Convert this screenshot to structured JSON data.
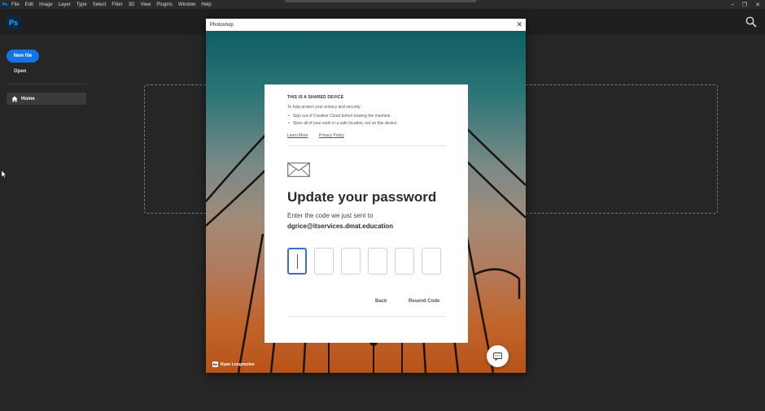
{
  "menubar": {
    "app_badge": "Ps",
    "items": [
      "File",
      "Edit",
      "Image",
      "Layer",
      "Type",
      "Select",
      "Filter",
      "3D",
      "View",
      "Plugins",
      "Window",
      "Help"
    ]
  },
  "appbar": {
    "logo": "Ps",
    "search_icon": "search-icon"
  },
  "sidebar": {
    "new_file": "New file",
    "open": "Open",
    "home": "Home"
  },
  "dialog": {
    "title": "Photoshop",
    "close": "✕",
    "credit": "Ryan Longnecker",
    "credit_badge": "Be"
  },
  "card": {
    "notice_heading": "THIS IS A SHARED DEVICE",
    "notice_intro": "To help protect your privacy and security:",
    "bullets": [
      "Sign out of Creative Cloud before leaving the machine.",
      "Store all of your work in a safe location, not on this device."
    ],
    "learn_more": "Learn More",
    "privacy_policy": "Privacy Policy",
    "heading": "Update your password",
    "sent_to": "Enter the code we just sent to",
    "email": "dgrice@itservices.dmat.education",
    "code_digits": [
      "",
      "",
      "",
      "",
      "",
      ""
    ],
    "back": "Back",
    "resend": "Resend Code"
  },
  "colors": {
    "accent": "#1473e6",
    "focus": "#3a6fd0",
    "background": "#262626"
  }
}
